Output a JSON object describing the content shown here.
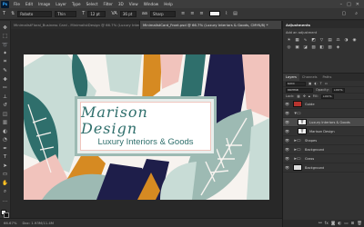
{
  "menubar": {
    "app_icon": "Ps",
    "items": [
      "File",
      "Edit",
      "Image",
      "Layer",
      "Type",
      "Select",
      "Filter",
      "3D",
      "View",
      "Window",
      "Help"
    ],
    "window_controls": [
      "–",
      "□",
      "✕"
    ]
  },
  "options": {
    "font_family": "Roboto",
    "font_style": "Thin",
    "font_size": "12 pt",
    "tracking": "36 pt",
    "antialias": "Sharp",
    "color": "#f3f3f3"
  },
  "tabs": [
    {
      "label": "MinimalistFloral_Business Card - MinimalistDesign @ 66.7% (Luxury Interiors & Goods, RGB/8...",
      "active": false
    },
    {
      "label": "MinimalistCard_Front.psd @ 66.7% (Luxury Interiors & Goods, CMYK/8) *",
      "active": true
    }
  ],
  "document": {
    "brand_name": "Marison Design",
    "tagline": "Luxury Interiors & Goods",
    "colors": {
      "teal": "#2f6f6c",
      "sage": "#9dbab3",
      "mint": "#c8dcd6",
      "navy": "#1e1e4a",
      "mustard": "#d68a22",
      "blush": "#f1c3bc",
      "cream": "#f7f3ef"
    }
  },
  "statusbar": {
    "zoom": "66.67%",
    "doc_info": "Doc: 1.93M/11.4M"
  },
  "adjustments": {
    "title": "Adjustments",
    "subtitle": "Add an adjustment",
    "icons": [
      "brightness-icon",
      "levels-icon",
      "curves-icon",
      "exposure-icon",
      "vibrance-icon",
      "hue-icon",
      "balance-icon",
      "bw-icon",
      "photo-filter-icon",
      "mixer-icon",
      "lookup-icon",
      "invert-icon",
      "posterize-icon",
      "threshold-icon",
      "gradient-map-icon",
      "selective-color-icon"
    ]
  },
  "layers_panel": {
    "tabs": [
      "Layers",
      "Channels",
      "Paths"
    ],
    "kind_label": "Kind",
    "blend_mode": "Normal",
    "opacity_label": "Opacity:",
    "opacity": "100%",
    "lock_label": "Lock:",
    "fill_label": "Fill:",
    "fill": "100%",
    "layers": [
      {
        "name": "Guide",
        "type": "color",
        "selected": false,
        "indent": false
      },
      {
        "name": "",
        "type": "group",
        "selected": false,
        "indent": false
      },
      {
        "name": "Luxury Interiors & Goods",
        "type": "text",
        "selected": true,
        "indent": true
      },
      {
        "name": "Marison Design",
        "type": "text",
        "selected": false,
        "indent": true
      },
      {
        "name": "Shapes",
        "type": "group",
        "selected": false,
        "indent": false
      },
      {
        "name": "Background",
        "type": "group",
        "selected": false,
        "indent": false
      },
      {
        "name": "Grass",
        "type": "group",
        "selected": false,
        "indent": false
      },
      {
        "name": "Background",
        "type": "image",
        "selected": false,
        "indent": false
      }
    ]
  }
}
